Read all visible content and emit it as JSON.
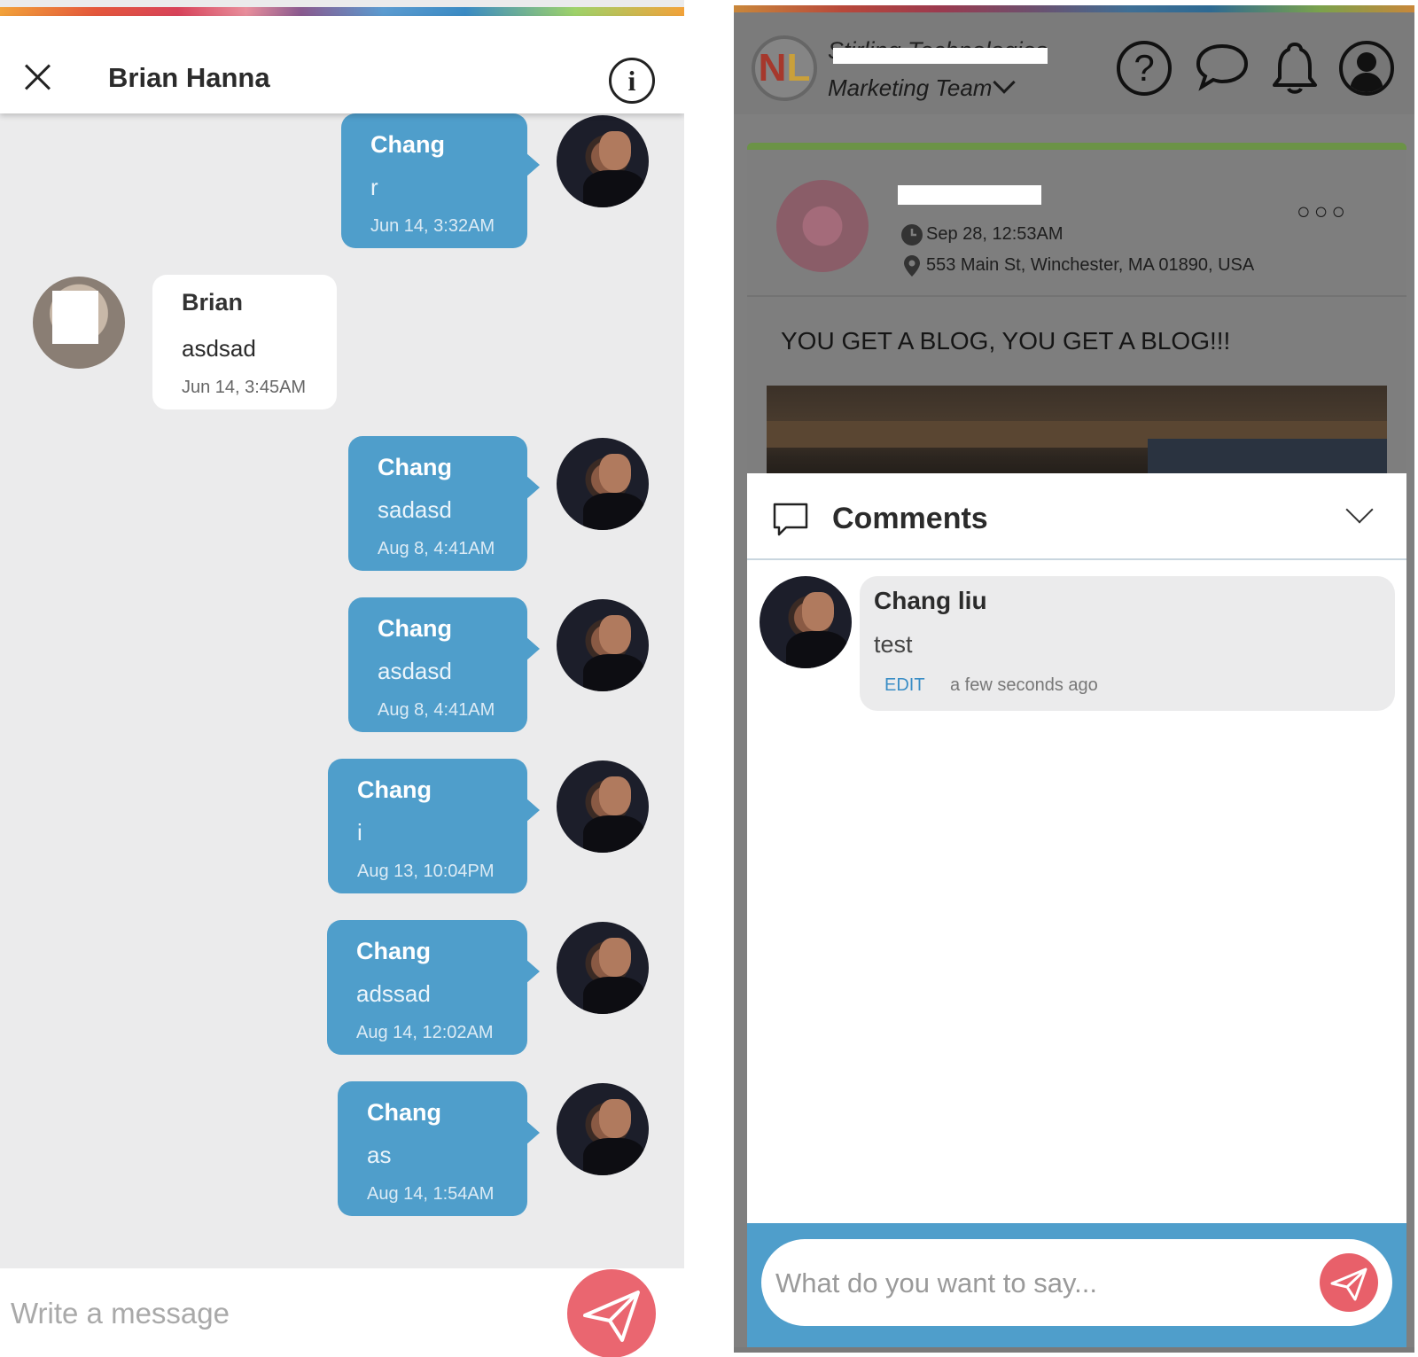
{
  "left_panel": {
    "header": {
      "title": "Brian Hanna"
    },
    "messages": [
      {
        "sender": "Chang",
        "text": "r",
        "time": "Jun 14, 3:32AM",
        "direction": "out"
      },
      {
        "sender": "Brian",
        "text": "asdsad",
        "time": "Jun 14, 3:45AM",
        "direction": "in"
      },
      {
        "sender": "Chang",
        "text": "sadasd",
        "time": "Aug 8, 4:41AM",
        "direction": "out"
      },
      {
        "sender": "Chang",
        "text": "asdasd",
        "time": "Aug 8, 4:41AM",
        "direction": "out"
      },
      {
        "sender": "Chang",
        "text": "i",
        "time": "Aug 13, 10:04PM",
        "direction": "out"
      },
      {
        "sender": "Chang",
        "text": "adssad",
        "time": "Aug 14, 12:02AM",
        "direction": "out"
      },
      {
        "sender": "Chang",
        "text": "as",
        "time": "Aug 14, 1:54AM",
        "direction": "out"
      }
    ],
    "composer": {
      "placeholder": "Write a message"
    }
  },
  "right_panel": {
    "header": {
      "org_name": "Stirling Technologies",
      "team": "Marketing Team"
    },
    "post": {
      "time": "Sep 28, 12:53AM",
      "location": "553 Main St, Winchester, MA 01890, USA",
      "title": "YOU GET A BLOG, YOU GET A BLOG!!!"
    },
    "comments": {
      "label": "Comments",
      "items": [
        {
          "author": "Chang liu",
          "text": "test",
          "edit_label": "EDIT",
          "time_ago": "a few seconds ago"
        }
      ],
      "composer": {
        "placeholder": "What do you want to say..."
      }
    }
  },
  "colors": {
    "outgoing_bubble": "#4f9ecb",
    "send_button": "#ea6670",
    "post_accent": "#6b9346",
    "edit_link": "#3b8ec6"
  }
}
